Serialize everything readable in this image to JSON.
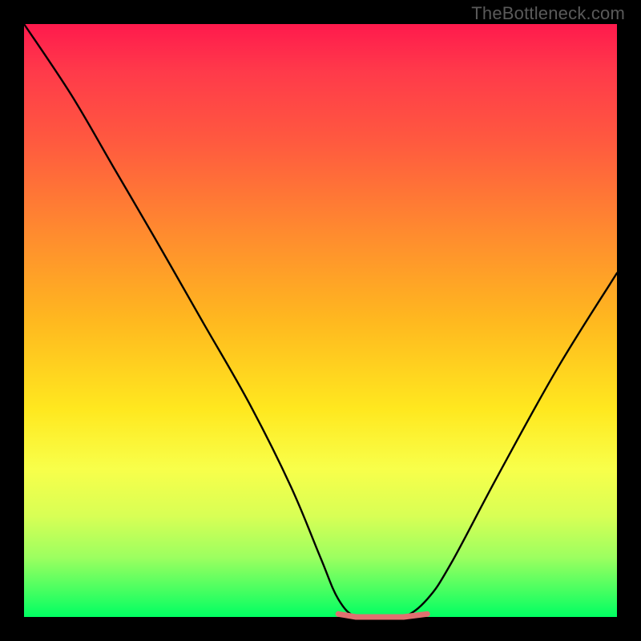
{
  "watermark": "TheBottleneck.com",
  "colors": {
    "gradient_top": "#ff1a4d",
    "gradient_mid1": "#ff8a2f",
    "gradient_mid2": "#ffe81f",
    "gradient_bottom": "#00ff62",
    "frame": "#000000",
    "curve": "#000000",
    "flat_band": "#e07070"
  },
  "chart_data": {
    "type": "line",
    "title": "",
    "xlabel": "",
    "ylabel": "",
    "xlim": [
      0,
      100
    ],
    "ylim": [
      0,
      100
    ],
    "grid": false,
    "series": [
      {
        "name": "bottleneck-curve",
        "x": [
          0,
          8,
          15,
          22,
          30,
          38,
          45,
          50,
          53,
          56,
          60,
          64,
          68,
          72,
          80,
          90,
          100
        ],
        "y": [
          100,
          88,
          76,
          64,
          50,
          36,
          22,
          10,
          3,
          0,
          0,
          0,
          3,
          9,
          24,
          42,
          58
        ]
      },
      {
        "name": "flat-band",
        "x": [
          53,
          56,
          60,
          64,
          68
        ],
        "y": [
          0.5,
          0,
          0,
          0,
          0.5
        ]
      }
    ],
    "annotations": [
      {
        "text": "TheBottleneck.com",
        "position": "top-right"
      }
    ]
  }
}
